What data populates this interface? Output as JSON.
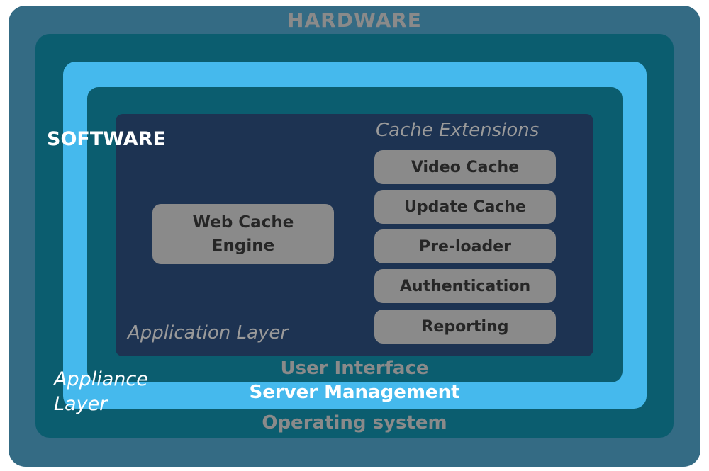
{
  "colors": {
    "background": "#ffffff",
    "hardware_fill": "#346b84",
    "os_fill": "#0b5d6f",
    "appliance_fill": "#45b9ed",
    "software_fill": "#0b5d6f",
    "app_layer_fill": "#1d3352",
    "module_fill": "#8a8a8a",
    "module_text": "#262626",
    "muted_label": "#8a8a8a",
    "white_label": "#ffffff",
    "italic_label": "#9a9a9a",
    "appliance_label": "#ffffff"
  },
  "layers": {
    "hardware": "HARDWARE",
    "operating_system": "Operating system",
    "server_management": "Server Management",
    "user_interface": "User Interface",
    "software": "SOFTWARE",
    "appliance": "Appliance Layer",
    "application": "Application Layer"
  },
  "web_cache_engine": "Web Cache Engine",
  "cache_extensions": {
    "title": "Cache Extensions",
    "items": [
      "Video Cache",
      "Update Cache",
      "Pre-loader",
      "Authentication",
      "Reporting"
    ]
  }
}
